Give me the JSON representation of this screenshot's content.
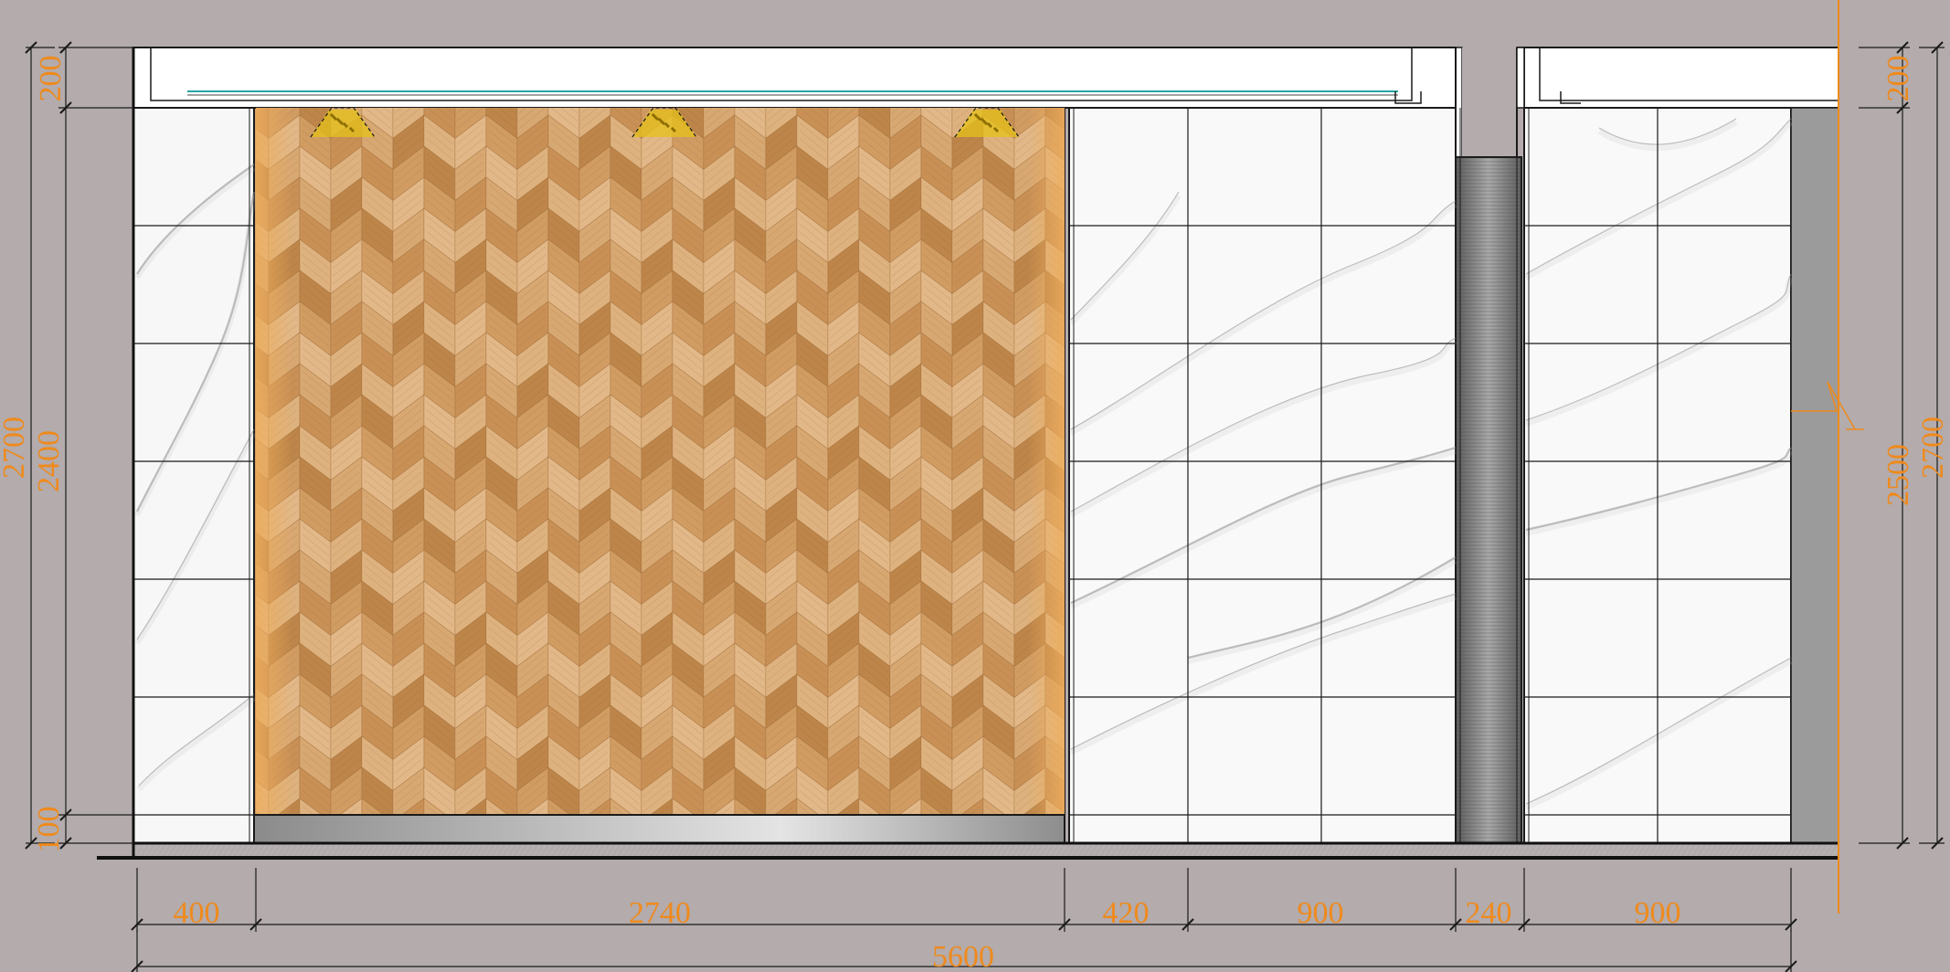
{
  "drawing": {
    "type": "interior wall elevation",
    "colors": {
      "background": "#b3abac",
      "dimension_text": "#ef8a1c",
      "line": "#1a1a1a",
      "wood_light": "#d8a872",
      "wood_dark": "#b27a45",
      "wood_edge": "#e9a859",
      "marble_vein": "#8a8a8a",
      "steel": "#6f6f6f",
      "side_wall": "#9b9b9b",
      "light_fixture": "#e6c21a",
      "cove_light": "#2aa4a4"
    },
    "bottom_dimensions": {
      "segments": [
        "400",
        "2740",
        "420",
        "900",
        "240",
        "900"
      ],
      "total": "5600"
    },
    "left_dimensions": {
      "ceiling": "200",
      "wall": "2400",
      "base": "100",
      "overall": "2700"
    },
    "right_dimensions": {
      "ceiling": "200",
      "wall": "2500",
      "overall": "2700"
    },
    "panels": [
      {
        "name": "marble panel",
        "material": "white marble",
        "width_mm": 400
      },
      {
        "name": "herringbone wood panel",
        "material": "chevron wood veneer",
        "width_mm": 2740
      },
      {
        "name": "marble panel",
        "material": "white marble",
        "width_mm": 420
      },
      {
        "name": "marble panel",
        "material": "white marble",
        "width_mm": 900
      },
      {
        "name": "steel column",
        "material": "brushed stainless steel",
        "width_mm": 240
      },
      {
        "name": "marble panel",
        "material": "white marble",
        "width_mm": 900
      }
    ],
    "fixtures": [
      "spot-light-1",
      "spot-light-2",
      "spot-light-3"
    ]
  }
}
